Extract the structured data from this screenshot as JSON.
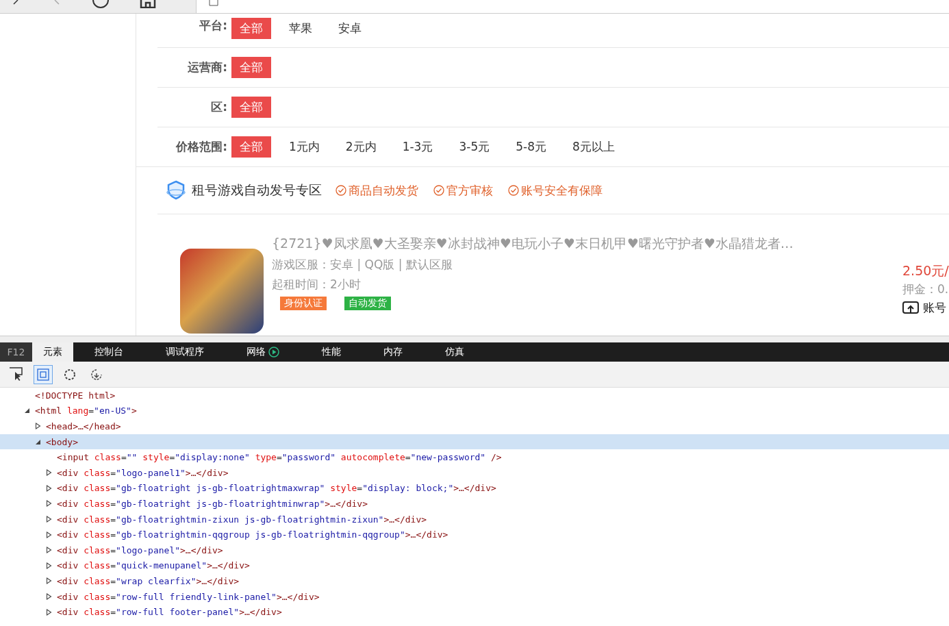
{
  "filters": [
    {
      "label": "平台:",
      "options": [
        {
          "text": "全部",
          "selected": true
        },
        {
          "text": "苹果",
          "selected": false
        },
        {
          "text": "安卓",
          "selected": false
        }
      ]
    },
    {
      "label": "运营商:",
      "options": [
        {
          "text": "全部",
          "selected": true
        }
      ]
    },
    {
      "label": "区:",
      "options": [
        {
          "text": "全部",
          "selected": true
        }
      ]
    },
    {
      "label": "价格范围:",
      "options": [
        {
          "text": "全部",
          "selected": true
        },
        {
          "text": "1元内",
          "selected": false
        },
        {
          "text": "2元内",
          "selected": false
        },
        {
          "text": "1-3元",
          "selected": false
        },
        {
          "text": "3-5元",
          "selected": false
        },
        {
          "text": "5-8元",
          "selected": false
        },
        {
          "text": "8元以上",
          "selected": false
        }
      ]
    }
  ],
  "zone": {
    "title": "租号游戏自动发号专区",
    "features": [
      "商品自动发货",
      "官方审核",
      "账号安全有保障"
    ]
  },
  "product": {
    "title": "{2721}♥凤求凰♥大圣娶亲♥冰封战神♥电玩小子♥末日机甲♥曙光守护者♥水晶猎龙者…",
    "server": "游戏区服：安卓 | QQ版 | 默认区服",
    "min_time": "起租时间：2小时",
    "tags": [
      {
        "text": "身份认证",
        "color": "#f5793a"
      },
      {
        "text": "自动发货",
        "color": "#2db245"
      }
    ],
    "price": "2.50元/",
    "deposit": "押金：0.",
    "account": "账号"
  },
  "devtools": {
    "label": "F12",
    "tabs": [
      {
        "text": "元素",
        "selected": true
      },
      {
        "text": "控制台",
        "selected": false
      },
      {
        "text": "调试程序",
        "selected": false
      },
      {
        "text": "网络",
        "selected": false,
        "recording": true
      },
      {
        "text": "性能",
        "selected": false
      },
      {
        "text": "内存",
        "selected": false
      },
      {
        "text": "仿真",
        "selected": false
      }
    ],
    "tools": [
      {
        "kind": "select",
        "selected": false
      },
      {
        "kind": "box",
        "selected": true
      },
      {
        "kind": "circle",
        "selected": false
      },
      {
        "kind": "refresh",
        "selected": false
      }
    ],
    "tree": [
      {
        "parts": [
          {
            "kind": "tag",
            "text": "<!DOCTYPE html>"
          }
        ]
      },
      {
        "expanded": true,
        "selected": false,
        "parts": [
          {
            "kind": "tag",
            "text": "<html "
          },
          {
            "kind": "attr",
            "text": "lang"
          },
          {
            "kind": "punc",
            "text": "="
          },
          {
            "kind": "val",
            "text": "\"en-US\""
          },
          {
            "kind": "tag",
            "text": ">"
          }
        ],
        "children": [
          {
            "expanded": false,
            "selected": false,
            "parts": [
              {
                "kind": "tag",
                "text": "<head>…</head>"
              }
            ]
          },
          {
            "expanded": true,
            "selected": true,
            "parts": [
              {
                "kind": "tag",
                "text": "<body>"
              }
            ],
            "children": [
              {
                "parts": [
                  {
                    "kind": "tag",
                    "text": "<input "
                  },
                  {
                    "kind": "attr",
                    "text": "class"
                  },
                  {
                    "kind": "punc",
                    "text": "="
                  },
                  {
                    "kind": "val",
                    "text": "\"\" "
                  },
                  {
                    "kind": "attr",
                    "text": "style"
                  },
                  {
                    "kind": "punc",
                    "text": "="
                  },
                  {
                    "kind": "val",
                    "text": "\"display:none\" "
                  },
                  {
                    "kind": "attr",
                    "text": "type"
                  },
                  {
                    "kind": "punc",
                    "text": "="
                  },
                  {
                    "kind": "val",
                    "text": "\"password\" "
                  },
                  {
                    "kind": "attr",
                    "text": "autocomplete"
                  },
                  {
                    "kind": "punc",
                    "text": "="
                  },
                  {
                    "kind": "val",
                    "text": "\"new-password\" "
                  },
                  {
                    "kind": "tag",
                    "text": "/>"
                  }
                ]
              },
              {
                "expanded": false,
                "selected": false,
                "parts": [
                  {
                    "kind": "tag",
                    "text": "<div "
                  },
                  {
                    "kind": "attr",
                    "text": "class"
                  },
                  {
                    "kind": "punc",
                    "text": "="
                  },
                  {
                    "kind": "val",
                    "text": "\"logo-panel1\""
                  },
                  {
                    "kind": "tag",
                    "text": ">…</div>"
                  }
                ]
              },
              {
                "expanded": false,
                "selected": false,
                "parts": [
                  {
                    "kind": "tag",
                    "text": "<div "
                  },
                  {
                    "kind": "attr",
                    "text": "class"
                  },
                  {
                    "kind": "punc",
                    "text": "="
                  },
                  {
                    "kind": "val",
                    "text": "\"gb-floatright js-gb-floatrightmaxwrap\" "
                  },
                  {
                    "kind": "attr",
                    "text": "style"
                  },
                  {
                    "kind": "punc",
                    "text": "="
                  },
                  {
                    "kind": "val",
                    "text": "\"display: block;\""
                  },
                  {
                    "kind": "tag",
                    "text": ">…</div>"
                  }
                ]
              },
              {
                "expanded": false,
                "selected": false,
                "parts": [
                  {
                    "kind": "tag",
                    "text": "<div "
                  },
                  {
                    "kind": "attr",
                    "text": "class"
                  },
                  {
                    "kind": "punc",
                    "text": "="
                  },
                  {
                    "kind": "val",
                    "text": "\"gb-floatright js-gb-floatrightminwrap\""
                  },
                  {
                    "kind": "tag",
                    "text": ">…</div>"
                  }
                ]
              },
              {
                "expanded": false,
                "selected": false,
                "parts": [
                  {
                    "kind": "tag",
                    "text": "<div "
                  },
                  {
                    "kind": "attr",
                    "text": "class"
                  },
                  {
                    "kind": "punc",
                    "text": "="
                  },
                  {
                    "kind": "val",
                    "text": "\"gb-floatrightmin-zixun js-gb-floatrightmin-zixun\""
                  },
                  {
                    "kind": "tag",
                    "text": ">…</div>"
                  }
                ]
              },
              {
                "expanded": false,
                "selected": false,
                "parts": [
                  {
                    "kind": "tag",
                    "text": "<div "
                  },
                  {
                    "kind": "attr",
                    "text": "class"
                  },
                  {
                    "kind": "punc",
                    "text": "="
                  },
                  {
                    "kind": "val",
                    "text": "\"gb-floatrightmin-qqgroup js-gb-floatrightmin-qqgroup\""
                  },
                  {
                    "kind": "tag",
                    "text": ">…</div>"
                  }
                ]
              },
              {
                "expanded": false,
                "selected": false,
                "parts": [
                  {
                    "kind": "tag",
                    "text": "<div "
                  },
                  {
                    "kind": "attr",
                    "text": "class"
                  },
                  {
                    "kind": "punc",
                    "text": "="
                  },
                  {
                    "kind": "val",
                    "text": "\"logo-panel\""
                  },
                  {
                    "kind": "tag",
                    "text": ">…</div>"
                  }
                ]
              },
              {
                "expanded": false,
                "selected": false,
                "parts": [
                  {
                    "kind": "tag",
                    "text": "<div "
                  },
                  {
                    "kind": "attr",
                    "text": "class"
                  },
                  {
                    "kind": "punc",
                    "text": "="
                  },
                  {
                    "kind": "val",
                    "text": "\"quick-menupanel\""
                  },
                  {
                    "kind": "tag",
                    "text": ">…</div>"
                  }
                ]
              },
              {
                "expanded": false,
                "selected": false,
                "parts": [
                  {
                    "kind": "tag",
                    "text": "<div "
                  },
                  {
                    "kind": "attr",
                    "text": "class"
                  },
                  {
                    "kind": "punc",
                    "text": "="
                  },
                  {
                    "kind": "val",
                    "text": "\"wrap clearfix\""
                  },
                  {
                    "kind": "tag",
                    "text": ">…</div>"
                  }
                ]
              },
              {
                "expanded": false,
                "selected": false,
                "parts": [
                  {
                    "kind": "tag",
                    "text": "<div "
                  },
                  {
                    "kind": "attr",
                    "text": "class"
                  },
                  {
                    "kind": "punc",
                    "text": "="
                  },
                  {
                    "kind": "val",
                    "text": "\"row-full friendly-link-panel\""
                  },
                  {
                    "kind": "tag",
                    "text": ">…</div>"
                  }
                ]
              },
              {
                "expanded": false,
                "selected": false,
                "parts": [
                  {
                    "kind": "tag",
                    "text": "<div "
                  },
                  {
                    "kind": "attr",
                    "text": "class"
                  },
                  {
                    "kind": "punc",
                    "text": "="
                  },
                  {
                    "kind": "val",
                    "text": "\"row-full footer-panel\""
                  },
                  {
                    "kind": "tag",
                    "text": ">…</div>"
                  }
                ]
              }
            ]
          }
        ]
      }
    ]
  }
}
